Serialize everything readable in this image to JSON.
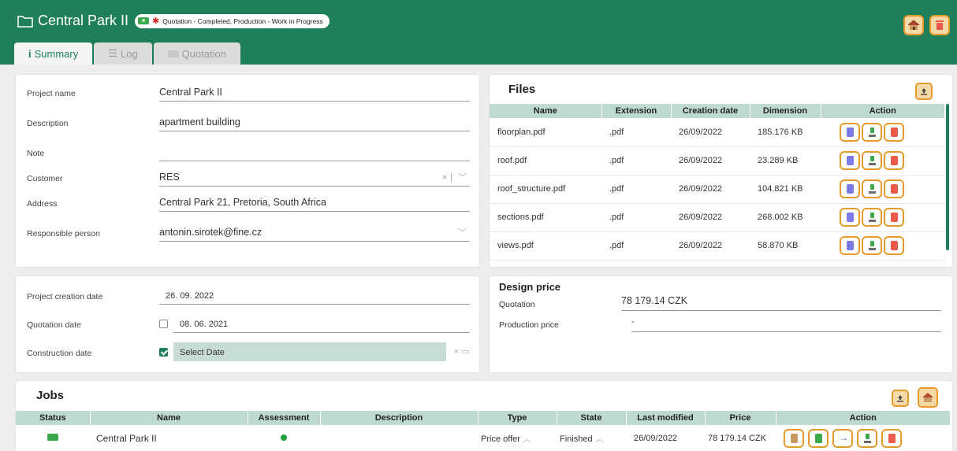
{
  "header": {
    "title": "Central Park II",
    "status_text": "Quotation - Completed, Production - Work in Progress",
    "accent_color": "#1f7f5a"
  },
  "tabs": [
    {
      "label": "Summary",
      "icon": "info-icon",
      "active": true
    },
    {
      "label": "Log",
      "icon": "database-icon",
      "active": false
    },
    {
      "label": "Quotation",
      "icon": "money-icon",
      "active": false
    }
  ],
  "project": {
    "name_label": "Project name",
    "name_value": "Central Park II",
    "description_label": "Description",
    "description_value": "apartment building",
    "note_label": "Note",
    "note_value": "",
    "customer_label": "Customer",
    "customer_value": "RES",
    "address_label": "Address",
    "address_value": "Central Park 21, Pretoria, South Africa",
    "responsible_label": "Responsible person",
    "responsible_value": "antonin.sirotek@fine.cz"
  },
  "dates": {
    "creation_label": "Project creation date",
    "creation_value": "26. 09. 2022",
    "quotation_label": "Quotation date",
    "quotation_value": "08. 06. 2021",
    "quotation_checked": false,
    "construction_label": "Construction date",
    "construction_placeholder": "Select Date",
    "construction_checked": true
  },
  "files": {
    "title": "Files",
    "columns": [
      "Name",
      "Extension",
      "Creation date",
      "Dimension",
      "Action"
    ],
    "rows": [
      {
        "name": "floorplan.pdf",
        "ext": ".pdf",
        "date": "26/09/2022",
        "size": "185.176 KB"
      },
      {
        "name": "roof.pdf",
        "ext": ".pdf",
        "date": "26/09/2022",
        "size": "23.289 KB"
      },
      {
        "name": "roof_structure.pdf",
        "ext": ".pdf",
        "date": "26/09/2022",
        "size": "104.821 KB"
      },
      {
        "name": "sections.pdf",
        "ext": ".pdf",
        "date": "26/09/2022",
        "size": "268.002 KB"
      },
      {
        "name": "views.pdf",
        "ext": ".pdf",
        "date": "26/09/2022",
        "size": "58.870 KB"
      }
    ]
  },
  "design_price": {
    "title": "Design price",
    "quotation_label": "Quotation",
    "quotation_value": "78 179.14 CZK",
    "production_label": "Production price",
    "production_value": "-"
  },
  "jobs": {
    "title": "Jobs",
    "columns": [
      "Status",
      "Name",
      "Assessment",
      "Description",
      "Type",
      "State",
      "Last modified",
      "Price",
      "Action"
    ],
    "rows": [
      {
        "name": "Central Park II",
        "type": "Price offer",
        "state": "Finished",
        "modified": "26/09/2022",
        "price": "78 179.14 CZK"
      }
    ]
  }
}
